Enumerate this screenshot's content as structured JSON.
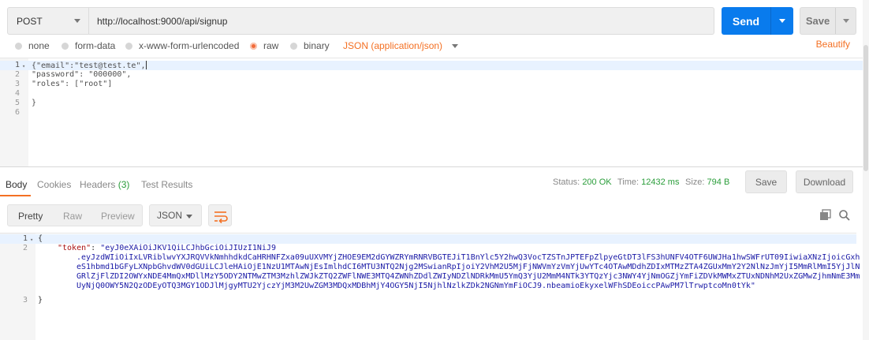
{
  "request": {
    "method": "POST",
    "url": "http://localhost:9000/api/signup",
    "send_label": "Send",
    "save_label": "Save"
  },
  "body_options": {
    "items": [
      "none",
      "form-data",
      "x-www-form-urlencoded",
      "raw",
      "binary"
    ],
    "selected": "raw",
    "content_type": "JSON (application/json)",
    "beautify_label": "Beautify"
  },
  "request_body": {
    "line_numbers": [
      "1",
      "2",
      "3",
      "4",
      "5",
      "6"
    ],
    "lines": [
      "{\"email\":\"test@test.te\",",
      "\"password\": \"000000\",",
      "\"roles\": [\"root\"]",
      "",
      "}",
      ""
    ]
  },
  "response_tabs": {
    "body": "Body",
    "cookies": "Cookies",
    "headers": "Headers",
    "headers_count": "(3)",
    "test_results": "Test Results"
  },
  "response_meta": {
    "status_label": "Status:",
    "status_value": "200 OK",
    "time_label": "Time:",
    "time_value": "12432 ms",
    "size_label": "Size:",
    "size_value": "794 B",
    "save_label": "Save",
    "download_label": "Download"
  },
  "response_toolbar": {
    "views": [
      "Pretty",
      "Raw",
      "Preview"
    ],
    "active_view": "Pretty",
    "format": "JSON"
  },
  "response_body": {
    "line_numbers": [
      "1",
      "2",
      "3"
    ],
    "open_brace": "{",
    "token_key": "\"token\"",
    "token_lines": [
      "\"eyJ0eXAiOiJKV1QiLCJhbGciOiJIUzI1NiJ9",
      ".eyJzdWIiOiIxLVRiblwvYXJRQVVkNmhhdkdCaHRHNFZxa09uUXVMYjZHOE9EM2dGYWZRYmRNRVBGTEJiT1BnYlc5Y2hwQ3VocTZSTnJPTEFpZlpyeGtDT3lFS3hUNFV4OTF6UWJHa1hwSWFrUT09IiwiaXNzIjoicGxh",
      "eS1hbmd1bGFyLXNpbGhvdWV0dGUiLCJleHAiOjE1NzU1MTAwNjEsImlhdCI6MTU3NTQ2Njg2MSwianRpIjoiY2VhM2U5MjFjNWVmYzVmYjUwYTc4OTAwMDdhZDIxMTMzZTA4ZGUxMmY2Y2NlNzJmYjI5MmRlMmI5YjJlN",
      "GRlZjFlZDI2OWYxNDE4MmQxMDllMzY5ODY2NTMwZTM3MzhlZWJkZTQ2ZWFlNWE3MTQ4ZWNhZDdlZWIyNDZlNDRkMmU5YmQ3YjU2MmM4NTk3YTQzYjc3NWY4YjNmOGZjYmFiZDVkMWMxZTUxNDNhM2UxZGMwZjhmNmE3Mm",
      "UyNjQ0OWY5N2QzODEyOTQ3MGY1ODJlMjgyMTU2YjczYjM3M2UwZGM3MDQxMDBhMjY4OGY5NjI5NjhlNzlkZDk2NGNmYmFiOCJ9.nbeamioEkyxelWFhSDEoiccPAwPM7lTrwptcoMn0tYk\""
    ],
    "close_brace": "}"
  }
}
